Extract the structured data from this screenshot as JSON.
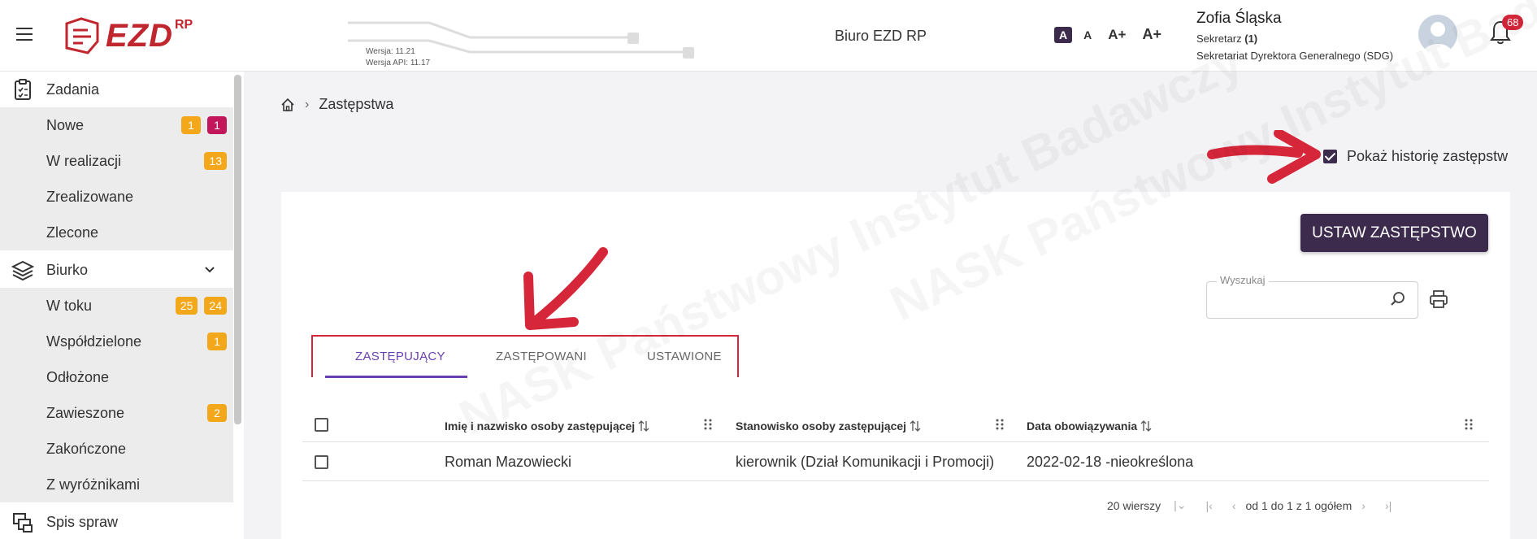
{
  "header": {
    "menu_icon": "hamburger-icon",
    "logo_text": "EZD",
    "logo_sup": "RP",
    "version": "Wersja: 11.21",
    "version_api": "Wersja API: 11.17",
    "app_title": "Biuro EZD RP",
    "font_buttons": [
      "A",
      "A",
      "A+",
      "A+"
    ],
    "user": {
      "name": "Zofia Śląska",
      "role_prefix": "Sekretarz ",
      "role_count": "(1)",
      "department": "Sekretariat Dyrektora Generalnego (SDG)"
    },
    "notifications_count": "68"
  },
  "sidebar": {
    "zadania": {
      "label": "Zadania",
      "icon": "clipboard-icon"
    },
    "zadania_items": [
      {
        "label": "Nowe",
        "badges": [
          "1",
          "1"
        ]
      },
      {
        "label": "W realizacji",
        "badges": [
          "13"
        ]
      },
      {
        "label": "Zrealizowane",
        "badges": []
      },
      {
        "label": "Zlecone",
        "badges": []
      }
    ],
    "biurko": {
      "label": "Biurko",
      "icon": "layers-icon"
    },
    "biurko_items": [
      {
        "label": "W toku",
        "badges": [
          "25",
          "24"
        ]
      },
      {
        "label": "Współdzielone",
        "badges": [
          "1"
        ]
      },
      {
        "label": "Odłożone",
        "badges": []
      },
      {
        "label": "Zawieszone",
        "badges": [
          "2"
        ]
      },
      {
        "label": "Zakończone",
        "badges": []
      },
      {
        "label": "Z wyróżnikami",
        "badges": []
      }
    ],
    "spis": {
      "label": "Spis spraw",
      "icon": "folders-icon"
    }
  },
  "breadcrumb": {
    "home_icon": "home-icon",
    "current": "Zastępstwa"
  },
  "history_checkbox": {
    "label": "Pokaż historię zastępstw",
    "checked": true
  },
  "primary_button": "USTAW ZASTĘPSTWO",
  "search": {
    "label": "Wyszukaj",
    "value": ""
  },
  "tabs": [
    "ZASTĘPUJĄCY",
    "ZASTĘPOWANI",
    "USTAWIONE"
  ],
  "table": {
    "headers": [
      "Imię i nazwisko osoby zastępującej",
      "Stanowisko osoby zastępującej",
      "Data obowiązywania"
    ],
    "rows": [
      [
        "Roman Mazowiecki",
        "kierownik (Dział Komunikacji i Promocji)",
        "2022-02-18 -nieokreślona"
      ]
    ]
  },
  "pager": {
    "rows_per_page": "20 wierszy",
    "range": "od 1 do 1 z 1 ogółem"
  },
  "watermark": "NASK Państwowy Instytut Badawczy",
  "colors": {
    "brand": "#3d2b4e",
    "accent": "#6a3fb0",
    "badge_orange": "#f3a81c",
    "badge_magenta": "#c2185b",
    "annotation_red": "#d6263a"
  }
}
